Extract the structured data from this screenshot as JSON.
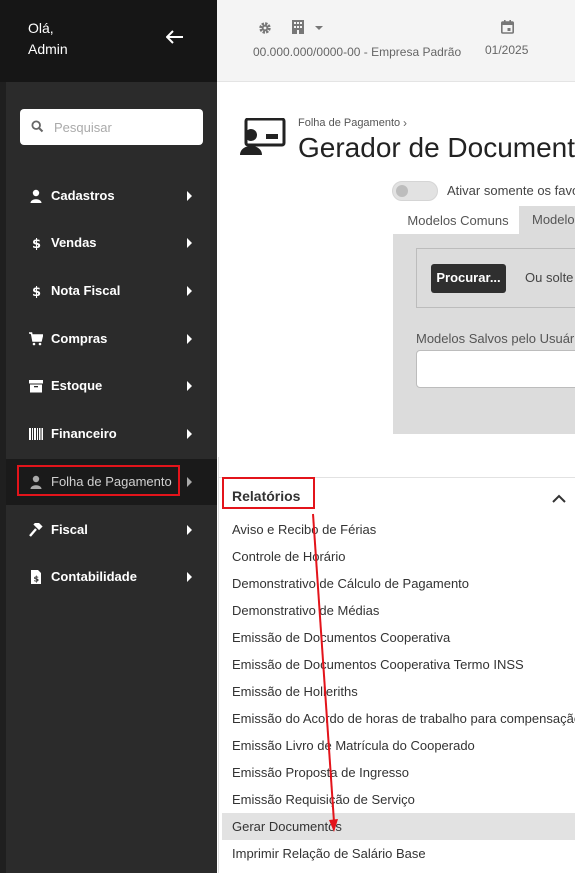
{
  "sidebar": {
    "greeting": "Olá,\nAdmin",
    "search_placeholder": "Pesquisar",
    "items": [
      {
        "label": "Cadastros",
        "icon": "user-icon"
      },
      {
        "label": "Vendas",
        "icon": "dollar-icon"
      },
      {
        "label": "Nota Fiscal",
        "icon": "dollar-icon"
      },
      {
        "label": "Compras",
        "icon": "cart-icon"
      },
      {
        "label": "Estoque",
        "icon": "archive-icon"
      },
      {
        "label": "Financeiro",
        "icon": "barcode-icon"
      },
      {
        "label": "Folha de Pagamento",
        "icon": "user-icon"
      },
      {
        "label": "Fiscal",
        "icon": "gavel-icon"
      },
      {
        "label": "Contabilidade",
        "icon": "file-dollar-icon"
      }
    ],
    "active_item": "Folha de Pagamento"
  },
  "topbar": {
    "company": "00.000.000/0000-00 - Empresa Padrão",
    "period": "01/2025"
  },
  "main": {
    "breadcrumb": "Folha de Pagamento",
    "title": "Gerador de Documentos",
    "toggle_label": "Ativar somente os favoritos",
    "tabs": [
      {
        "label": "Modelos Comuns",
        "active": false
      },
      {
        "label": "Modelos",
        "active": true
      }
    ],
    "browse_button": "Procurar...",
    "drop_text": "Ou solte arquivo aqui",
    "saved_label": "Modelos Salvos pelo Usuário"
  },
  "menu": {
    "title": "Relatórios",
    "items": [
      "Aviso e Recibo de Férias",
      "Controle de Horário",
      "Demonstrativo de Cálculo de Pagamento",
      "Demonstrativo de Médias",
      "Emissão de Documentos Cooperativa",
      "Emissão de Documentos Cooperativa Termo INSS",
      "Emissão de Hollerиths",
      "Emissão do Acordo de horas de trabalho para compensação",
      "Emissão Livro de Matrícula do Cooperado",
      "Emissão Proposta de Ingresso",
      "Emissão Requisição de Serviço",
      "Gerar Documentos",
      "Imprimir Relação de Salário Base"
    ],
    "highlighted_item": "Gerar Documentos"
  },
  "colors": {
    "sidebar_bg": "#2b2b2b",
    "sidebar_header_bg": "#161616",
    "annotation_red": "#e3141b",
    "button_dark": "#2f2f2f"
  }
}
